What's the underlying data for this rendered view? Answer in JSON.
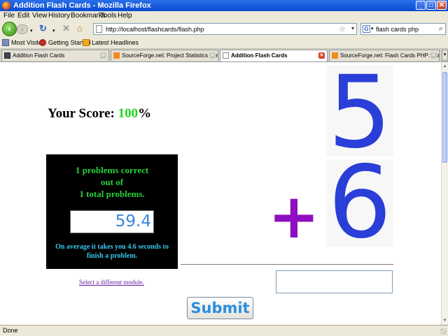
{
  "window": {
    "title": "Addition Flash Cards - Mozilla Firefox",
    "controls": {
      "minimize": "_",
      "maximize": "□",
      "close": "✕"
    }
  },
  "menu": [
    "File",
    "Edit",
    "View",
    "History",
    "Bookmarks",
    "Tools",
    "Help"
  ],
  "nav": {
    "url": "http://localhost/flashcards/flash.php",
    "search_value": "flash cards php",
    "search_engine_letter": "G"
  },
  "bookmarks": [
    "Most Visited",
    "Getting Started",
    "Latest Headlines"
  ],
  "tabs": [
    {
      "label": "Addition Flash Cards",
      "active": false
    },
    {
      "label": "SourceForge.net: Project Statistics For...",
      "active": false
    },
    {
      "label": "Addition Flash Cards",
      "active": true
    },
    {
      "label": "SourceForge.net: Flash Cards PHP: Scr...",
      "active": false
    }
  ],
  "score": {
    "label": "Your Score: ",
    "value": "100",
    "suffix": "%"
  },
  "stats": {
    "line1": "1 problems correct",
    "line2": "out of",
    "line3": "1 total problems.",
    "time_value": "59.4",
    "average_text": "On average it takes you 4.6 seconds to finish a problem."
  },
  "problem": {
    "top": "5",
    "operator": "+",
    "bottom": "6",
    "answer_value": ""
  },
  "links": {
    "module": "Select a different module."
  },
  "buttons": {
    "submit": "Submit"
  },
  "status": "Done",
  "colors": {
    "score_green": "#27d427",
    "digit_blue": "#2a3ed8",
    "operator_purple": "#8e0fbf",
    "stats_green": "#26d13a",
    "average_cyan": "#38c6ea",
    "time_blue": "#3a86d8"
  }
}
